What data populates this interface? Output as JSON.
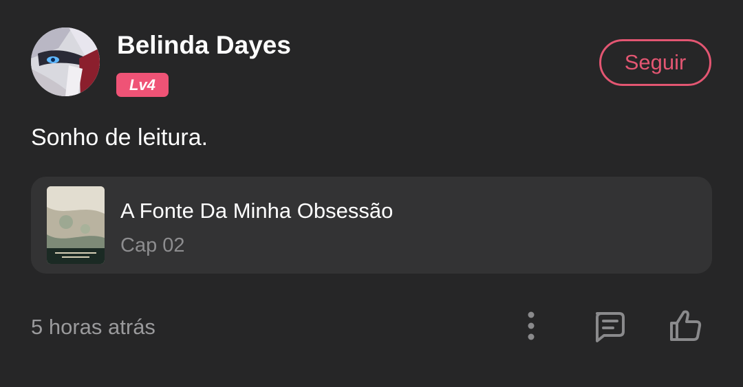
{
  "post": {
    "author": {
      "name": "Belinda Dayes",
      "level": "Lv4",
      "avatar_icon": "anime-avatar"
    },
    "follow_label": "Seguir",
    "text": "Sonho de leitura.",
    "work": {
      "title": "A Fonte Da Minha Obsessão",
      "chapter": "Cap 02",
      "cover_icon": "book-cover"
    },
    "timestamp": "5 horas atrás",
    "actions": {
      "more_icon": "more-vertical-icon",
      "comment_icon": "comment-icon",
      "like_icon": "thumbs-up-icon"
    }
  },
  "colors": {
    "background": "#262627",
    "card": "#333334",
    "accent": "#e35672",
    "badge": "#ef5376",
    "muted_text": "#9a9a9c",
    "icon": "#8a8a8c"
  }
}
